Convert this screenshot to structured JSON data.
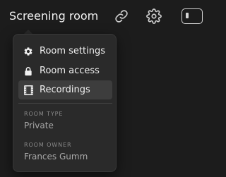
{
  "header": {
    "room_name": "Screening room",
    "icons": [
      "link-icon",
      "gear-icon",
      "panel-icon"
    ]
  },
  "menu": {
    "items": [
      {
        "label": "Room settings",
        "icon": "gear-icon",
        "active": false
      },
      {
        "label": "Room access",
        "icon": "lock-icon",
        "active": false
      },
      {
        "label": "Recordings",
        "icon": "film-icon",
        "active": true
      }
    ],
    "room_type": {
      "label": "ROOM TYPE",
      "value": "Private"
    },
    "room_owner": {
      "label": "ROOM OWNER",
      "value": "Frances Gumm"
    }
  },
  "colors": {
    "background": "#1c1c1c",
    "menu_background": "#2a2a2a",
    "active_item": "#3d3d3d",
    "text_primary": "#f0f0f0",
    "text_muted": "#8a8a8a"
  }
}
